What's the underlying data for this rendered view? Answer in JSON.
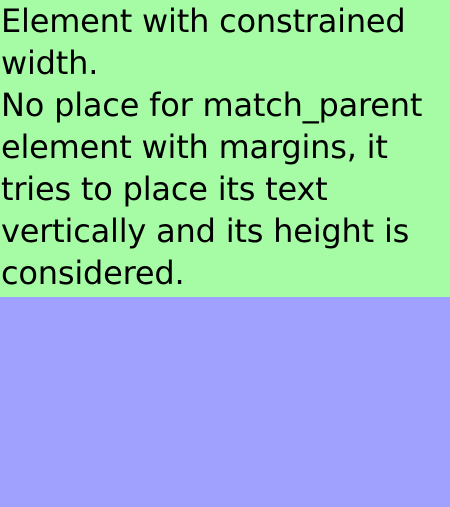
{
  "colors": {
    "text_block_background": "#a5fca5",
    "page_background": "#a0a0ff",
    "text": "#000000"
  },
  "text_block": {
    "lines": [
      "Element with constrained",
      "width.",
      "No place for match_parent",
      "element with margins, it",
      "tries to place its text",
      "vertically and its height is",
      "considered."
    ]
  }
}
